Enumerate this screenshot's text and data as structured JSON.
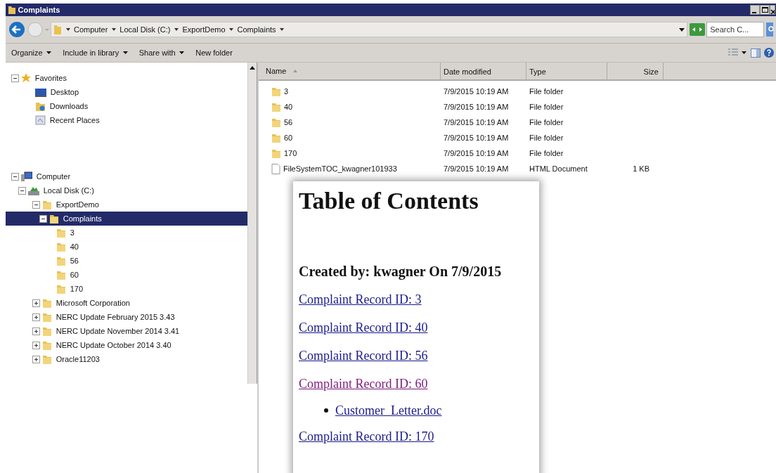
{
  "window": {
    "title": "Complaints"
  },
  "address_bar": {
    "breadcrumbs": [
      "Computer",
      "Local Disk (C:)",
      "ExportDemo",
      "Complaints"
    ],
    "search": {
      "placeholder": "Search C..."
    }
  },
  "toolbar": {
    "buttons": [
      {
        "label": "Organize",
        "dropdown": true
      },
      {
        "label": "Include in library",
        "dropdown": true
      },
      {
        "label": "Share with",
        "dropdown": true
      },
      {
        "label": "New folder",
        "dropdown": false
      }
    ]
  },
  "sidebar": {
    "groups": [
      {
        "label": "Favorites",
        "kind": "favorites",
        "expanded": true,
        "selected": false,
        "children": [
          {
            "label": "Desktop",
            "kind": "desktop",
            "selected": false
          },
          {
            "label": "Downloads",
            "kind": "downloads",
            "selected": false
          },
          {
            "label": "Recent Places",
            "kind": "recent",
            "selected": false
          }
        ]
      },
      {
        "label": "Computer",
        "kind": "computer",
        "expanded": true,
        "selected": false,
        "children": [
          {
            "label": "Local Disk (C:)",
            "kind": "drive",
            "expanded": true,
            "selected": false,
            "children": [
              {
                "label": "ExportDemo",
                "kind": "folder",
                "expanded": true,
                "selected": false,
                "children": [
                  {
                    "label": "Complaints",
                    "kind": "folder",
                    "expanded": true,
                    "selected": true,
                    "children": [
                      {
                        "label": "3",
                        "kind": "folder",
                        "selected": false
                      },
                      {
                        "label": "40",
                        "kind": "folder",
                        "selected": false
                      },
                      {
                        "label": "56",
                        "kind": "folder",
                        "selected": false
                      },
                      {
                        "label": "60",
                        "kind": "folder",
                        "selected": false
                      },
                      {
                        "label": "170",
                        "kind": "folder",
                        "selected": false
                      }
                    ]
                  }
                ]
              },
              {
                "label": "Microsoft Corporation",
                "kind": "folder",
                "expanded": false,
                "selected": false
              },
              {
                "label": "NERC Update February 2015 3.43",
                "kind": "folder",
                "expanded": false,
                "selected": false
              },
              {
                "label": "NERC Update November 2014 3.41",
                "kind": "folder",
                "expanded": false,
                "selected": false
              },
              {
                "label": "NERC Update October 2014 3.40",
                "kind": "folder",
                "expanded": false,
                "selected": false
              },
              {
                "label": "Oracle11203",
                "kind": "folder",
                "expanded": false,
                "selected": false
              }
            ]
          }
        ]
      }
    ]
  },
  "table": {
    "columns": [
      "Name",
      "Date modified",
      "Type",
      "Size"
    ],
    "rows": [
      {
        "kind": "folder",
        "name": "3",
        "date": "7/9/2015 10:19 AM",
        "type": "File folder"
      },
      {
        "kind": "folder",
        "name": "40",
        "date": "7/9/2015 10:19 AM",
        "type": "File folder"
      },
      {
        "kind": "folder",
        "name": "56",
        "date": "7/9/2015 10:19 AM",
        "type": "File folder"
      },
      {
        "kind": "folder",
        "name": "60",
        "date": "7/9/2015 10:19 AM",
        "type": "File folder"
      },
      {
        "kind": "folder",
        "name": "170",
        "date": "7/9/2015 10:19 AM",
        "type": "File folder"
      },
      {
        "kind": "document",
        "name": "FileSystemTOC_kwagner101933",
        "date": "7/9/2015 10:19 AM",
        "type": "HTML Document",
        "size": "1 KB"
      }
    ]
  },
  "toc_page": {
    "title": "Table of Contents",
    "subtitle": "Created by: kwagner On 7/9/2015",
    "links": [
      {
        "label": "Complaint Record ID: 3",
        "visited": false
      },
      {
        "label": "Complaint Record ID: 40",
        "visited": false
      },
      {
        "label": "Complaint Record ID: 56",
        "visited": false
      },
      {
        "label": "Complaint Record ID: 60",
        "visited": true,
        "children": [
          {
            "label": "Customer_Letter.doc",
            "visited": false
          }
        ]
      },
      {
        "label": "Complaint Record ID: 170",
        "visited": false
      }
    ]
  }
}
